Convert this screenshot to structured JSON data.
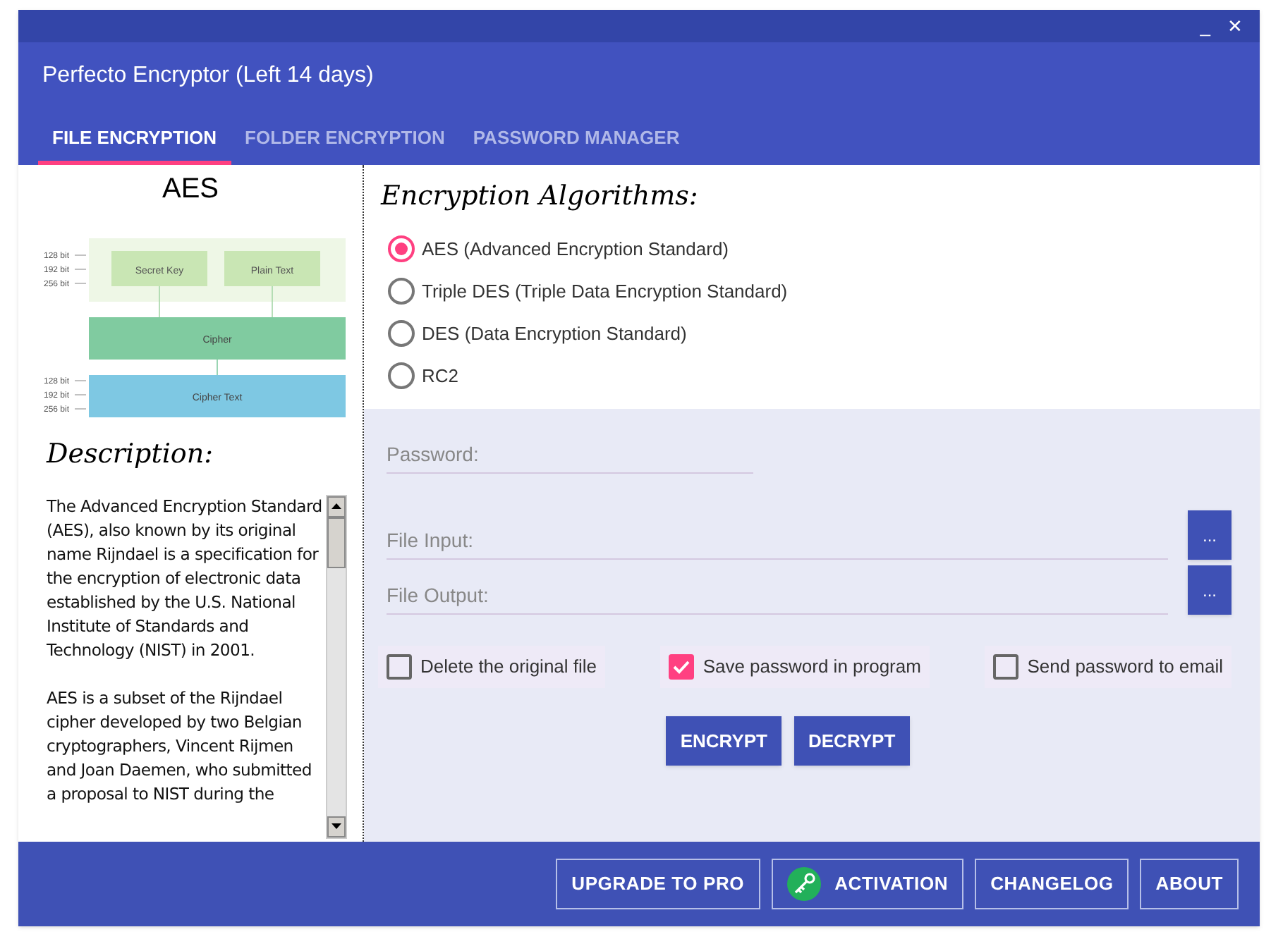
{
  "window": {
    "title": "Perfecto Encryptor (Left 14 days)",
    "controls": [
      "_",
      "✕"
    ]
  },
  "tabs": [
    {
      "label": "FILE ENCRYPTION",
      "selected": true
    },
    {
      "label": "FOLDER ENCRYPTION",
      "selected": false
    },
    {
      "label": "PASSWORD MANAGER",
      "selected": false
    }
  ],
  "algorithm_panel": {
    "title": "AES",
    "diagram": {
      "key_bits": [
        "128 bit",
        "192 bit",
        "256 bit"
      ],
      "inputs": [
        "Secret Key",
        "Plain Text"
      ],
      "cipher": "Cipher",
      "output_bits": [
        "128 bit",
        "192 bit",
        "256 bit"
      ],
      "output": "Cipher Text"
    },
    "description_title": "Description:",
    "description": [
      "The Advanced Encryption Standard (AES), also known by its original name Rijndael is a specification for the encryption of electronic data established by the U.S. National Institute of Standards and Technology (NIST) in 2001.",
      "AES is a subset of the Rijndael cipher developed by two Belgian cryptographers, Vincent Rijmen and Joan Daemen, who submitted a proposal to NIST during the"
    ]
  },
  "algorithms": {
    "title": "Encryption Algorithms:",
    "options": [
      {
        "label": "AES (Advanced Encryption Standard)",
        "selected": true
      },
      {
        "label": "Triple DES (Triple Data Encryption Standard)",
        "selected": false
      },
      {
        "label": "DES (Data Encryption Standard)",
        "selected": false
      },
      {
        "label": "RC2",
        "selected": false
      }
    ]
  },
  "fields": [
    {
      "placeholder": "Password:",
      "kind": "text"
    },
    {
      "placeholder": "File Input:",
      "kind": "file",
      "browse": "..."
    },
    {
      "placeholder": "File Output:",
      "kind": "file",
      "browse": "..."
    }
  ],
  "options": [
    {
      "label": "Delete the original file",
      "checked": false
    },
    {
      "label": "Save password in program",
      "checked": true
    },
    {
      "label": "Send password to email",
      "checked": false
    }
  ],
  "actions": [
    "ENCRYPT",
    "DECRYPT"
  ],
  "footer_buttons": [
    {
      "label": "UPGRADE TO PRO",
      "kind": "plain"
    },
    {
      "label": "ACTIVATION",
      "kind": "key"
    },
    {
      "label": "CHANGELOG",
      "kind": "plain"
    },
    {
      "label": "ABOUT",
      "kind": "plain"
    }
  ]
}
